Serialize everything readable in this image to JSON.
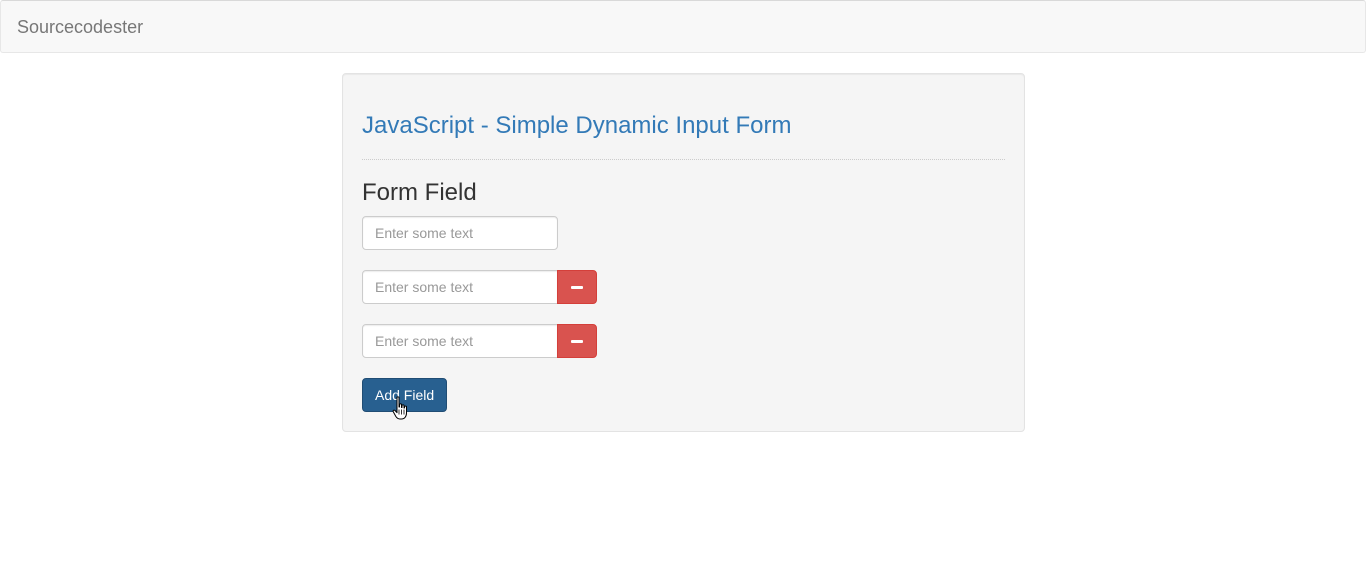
{
  "navbar": {
    "brand": "Sourcecodester"
  },
  "panel": {
    "title": "JavaScript - Simple Dynamic Input Form",
    "section_title": "Form Field",
    "fields": [
      {
        "placeholder": "Enter some text",
        "value": "",
        "removable": false
      },
      {
        "placeholder": "Enter some text",
        "value": "",
        "removable": true,
        "remove_icon": "minus-icon"
      },
      {
        "placeholder": "Enter some text",
        "value": "",
        "removable": true,
        "remove_icon": "minus-icon"
      }
    ],
    "add_button_label": "Add Field"
  },
  "colors": {
    "title": "#337ab7",
    "danger": "#d9534f",
    "primary": "#286090",
    "navbar_bg": "#f8f8f8",
    "well_bg": "#f5f5f5"
  },
  "cursor": {
    "icon": "hand-pointer-icon"
  }
}
